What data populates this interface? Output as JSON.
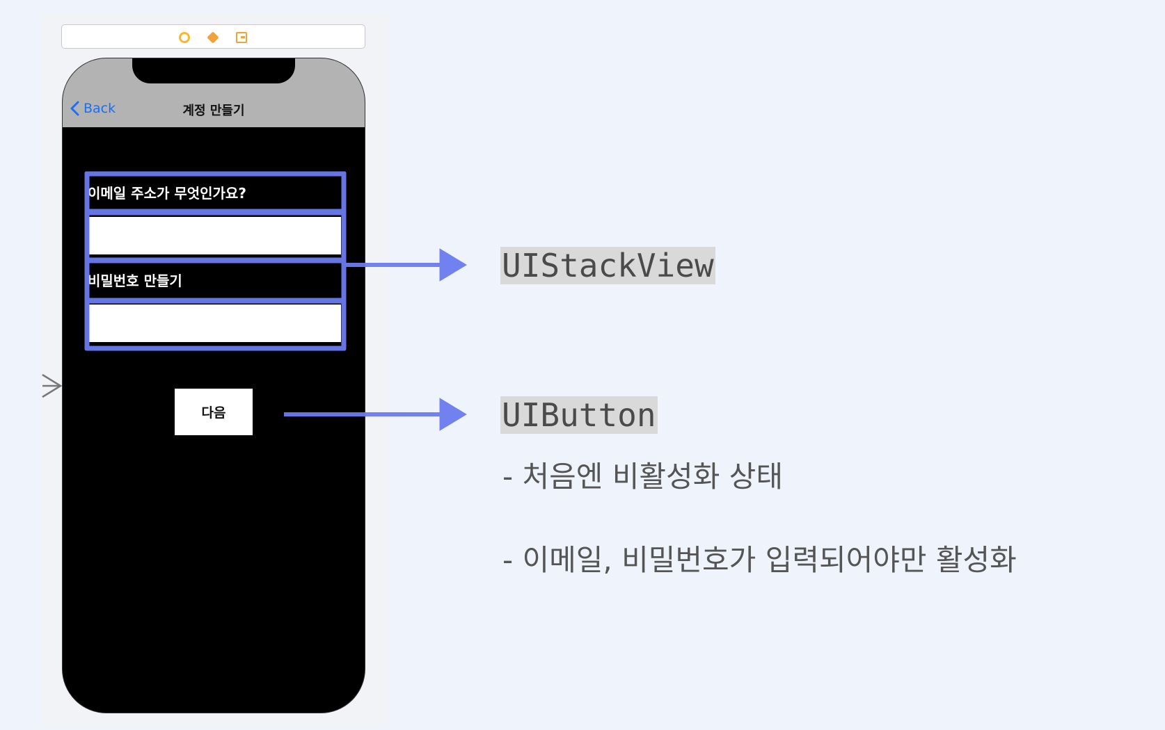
{
  "navigation": {
    "back_label": "Back",
    "title": "계정 만들기"
  },
  "form": {
    "email_label": "이메일 주소가 무엇인가요?",
    "email_value": "",
    "password_label": "비밀번호 만들기",
    "password_value": "",
    "next_button_label": "다음"
  },
  "annotations": {
    "stack_view_tag": "UIStackView",
    "button_tag": "UIButton",
    "button_notes": [
      "- 처음엔 비활성화 상태",
      "- 이메일, 비밀번호가 입력되어야만 활성화"
    ]
  },
  "colors": {
    "background": "#eff4fc",
    "highlight": "#6b7cf0",
    "link": "#1c6ef2",
    "navbar": "#b3b3b3"
  },
  "icons": [
    "view-controller-icon",
    "first-responder-icon",
    "exit-icon",
    "entry-point-arrow-icon",
    "chevron-left-icon"
  ]
}
